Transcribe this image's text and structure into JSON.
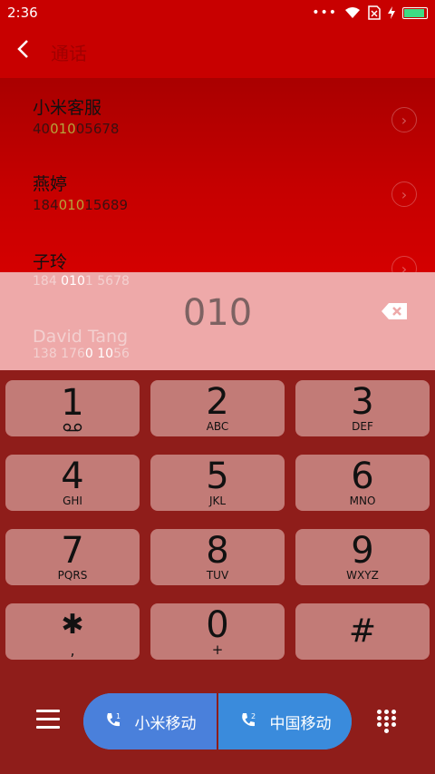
{
  "status": {
    "time": "2:36"
  },
  "header": {
    "title": "通话"
  },
  "contacts": [
    {
      "name": "小米客服",
      "num_pre": "40",
      "num_hl": "010",
      "num_post": "05678"
    },
    {
      "name": "燕婷",
      "num_pre": "184",
      "num_hl": "010",
      "num_post": "15689"
    },
    {
      "name": "子玲",
      "num_pre": "184 ",
      "num_hl": "010",
      "num_post": "1 5678"
    },
    {
      "name": "David Tang",
      "num_pre": "138 176",
      "num_hl": "0 10",
      "num_post": "56"
    }
  ],
  "dialer": {
    "input": "010",
    "keys": [
      {
        "digit": "1",
        "letters": ""
      },
      {
        "digit": "2",
        "letters": "ABC"
      },
      {
        "digit": "3",
        "letters": "DEF"
      },
      {
        "digit": "4",
        "letters": "GHI"
      },
      {
        "digit": "5",
        "letters": "JKL"
      },
      {
        "digit": "6",
        "letters": "MNO"
      },
      {
        "digit": "7",
        "letters": "PQRS"
      },
      {
        "digit": "8",
        "letters": "TUV"
      },
      {
        "digit": "9",
        "letters": "WXYZ"
      },
      {
        "digit": "✱",
        "letters": ","
      },
      {
        "digit": "0",
        "letters": "+"
      },
      {
        "digit": "#",
        "letters": ""
      }
    ]
  },
  "call": {
    "sim1_label": "小米移动",
    "sim2_label": "中国移动"
  },
  "colors": {
    "accent": "#c80000",
    "key_bg": "#c27b77",
    "call_blue": "#4a80db"
  }
}
